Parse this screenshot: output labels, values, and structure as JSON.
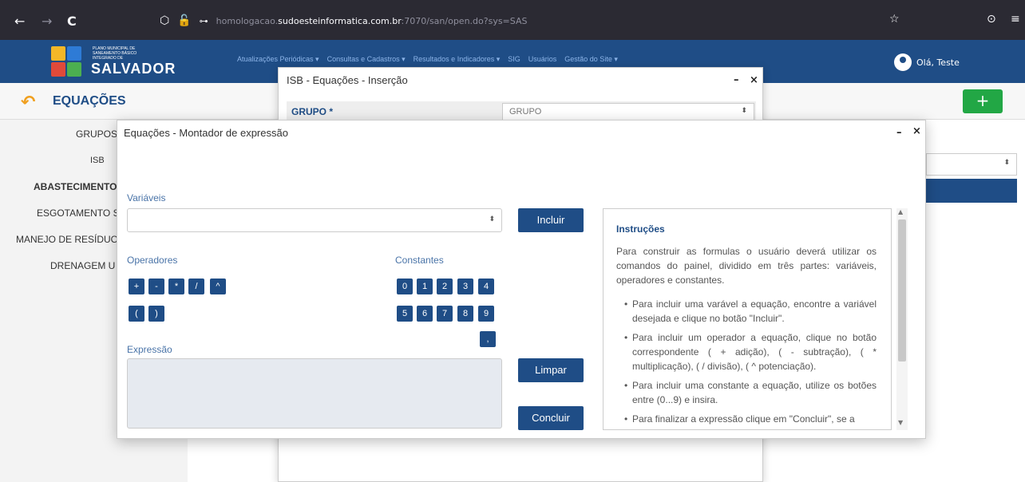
{
  "browser": {
    "back": "←",
    "forward": "→",
    "reload": "C",
    "url_prefix": "homologacao.",
    "url_domain": "sudoesteinformatica.com.br",
    "url_suffix": ":7070/san/open.do?sys=SAS",
    "star": "☆",
    "shield": "⊙",
    "menu": "≡"
  },
  "app": {
    "logo_line1": "PLANO MUNICIPAL DE",
    "logo_line2": "SANEAMENTO BÁSICO",
    "logo_line3": "INTEGRADO DE",
    "logo_name": "SALVADOR",
    "menu": [
      "Atualizações Periódicas ▾",
      "Consultas e Cadastros ▾",
      "Resultados e Indicadores ▾",
      "SIG",
      "Usuários",
      "Gestão do Site ▾"
    ],
    "user_greeting": "Olá, Teste"
  },
  "page": {
    "title": "EQUAÇÕES",
    "add_label": "+",
    "left_items": [
      "GRUPOS",
      "ISB",
      "ABASTECIMENTO",
      "ESGOTAMENTO S",
      "MANEJO DE RESÍDUO",
      "DRENAGEM U"
    ]
  },
  "insert_dialog": {
    "title": "ISB - Equações - Inserção",
    "minimize": "–",
    "close": "×",
    "group_label": "GRUPO *",
    "group_placeholder": "GRUPO"
  },
  "builder": {
    "title": "Equações - Montador de expressão",
    "minimize": "–",
    "close": "×",
    "variables_label": "Variáveis",
    "include_button": "Incluir",
    "operators_label": "Operadores",
    "operators_row1": [
      "+",
      "-",
      "*",
      "/",
      "^"
    ],
    "operators_row2": [
      "(",
      ")"
    ],
    "constants_label": "Constantes",
    "constants_row1": [
      "0",
      "1",
      "2",
      "3",
      "4"
    ],
    "constants_row2": [
      "5",
      "6",
      "7",
      "8",
      "9"
    ],
    "decimal": ",",
    "expression_label": "Expressão",
    "clear_button": "Limpar",
    "finish_button": "Concluir",
    "instructions": {
      "title": "Instruções",
      "intro": "Para construir as formulas o usuário deverá utilizar os comandos do painel, dividido em três partes: variáveis, operadores e constantes.",
      "items": [
        "Para incluir uma varável a equação, encontre a variável desejada e clique no botão \"Incluir\".",
        "Para incluir um operador a equação, clique no botão correspondente ( + adição), ( - subtração), ( * multiplicação), ( / divisão), ( ^ potenciação).",
        "Para incluir uma constante a equação, utilize os botões entre (0...9) e insira.",
        "Para finalizar a expressão clique em \"Concluir\", se a"
      ]
    }
  },
  "colors": {
    "primary": "#1f4d86",
    "accent_green": "#22a745",
    "back_arrow": "#f0a020"
  }
}
